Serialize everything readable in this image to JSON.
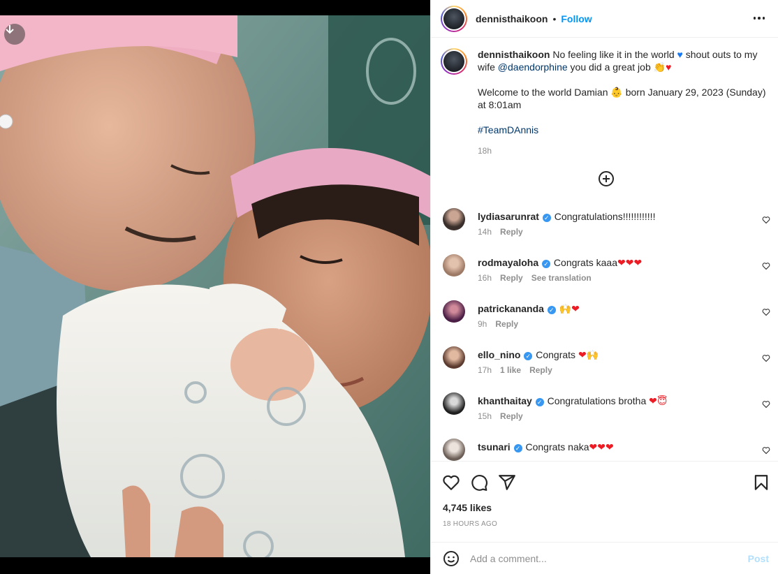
{
  "post": {
    "username": "dennisthaikoon",
    "dot": "•",
    "follow_label": "Follow",
    "caption_line1_pre": "No feeling like it in the world",
    "caption_line1_post": "shout outs to my wife",
    "mention": "@daendorphine",
    "caption_line1_end": "you did a great job",
    "caption_line2": "Welcome to the world Damian",
    "caption_line2_post": "born January 29, 2023 (Sunday) at 8:01am",
    "hashtag": "#TeamDAnnis",
    "caption_time": "18h"
  },
  "comments": [
    {
      "user": "lydiasarunrat",
      "verified": true,
      "text": "Congratulations!!!!!!!!!!!!",
      "emojis": "",
      "time": "14h",
      "likes": "",
      "reply": "Reply",
      "translate": "",
      "avatar_color": "#3a2f2b"
    },
    {
      "user": "rodmayaloha",
      "verified": true,
      "text": "Congrats kaaa",
      "emojis": "❤❤❤",
      "time": "16h",
      "likes": "",
      "reply": "Reply",
      "translate": "See translation",
      "avatar_color": "#c9a58c"
    },
    {
      "user": "patrickananda",
      "verified": true,
      "text": "",
      "emojis": "🙌❤",
      "time": "9h",
      "likes": "",
      "reply": "Reply",
      "translate": "",
      "avatar_color": "#6b2a5a"
    },
    {
      "user": "ello_nino",
      "verified": true,
      "text": "Congrats",
      "emojis": "❤🙌",
      "time": "17h",
      "likes": "1 like",
      "reply": "Reply",
      "translate": "",
      "avatar_color": "#8a5a44"
    },
    {
      "user": "khanthaitay",
      "verified": true,
      "text": "Congratulations brotha",
      "emojis": "❤😇",
      "time": "15h",
      "likes": "",
      "reply": "Reply",
      "translate": "",
      "avatar_color": "#2b2b2b"
    },
    {
      "user": "tsunari",
      "verified": true,
      "text": "Congrats naka",
      "emojis": "❤❤❤",
      "time": "",
      "likes": "",
      "reply": "",
      "translate": "",
      "avatar_color": "#9a8c82"
    }
  ],
  "footer": {
    "likes": "4,745 likes",
    "ago": "18 HOURS AGO",
    "add_comment_placeholder": "Add a comment...",
    "post_label": "Post"
  },
  "icons": {
    "download": "download-arrow-icon",
    "more": "more-horizontal-icon",
    "add_more": "plus-circle-icon",
    "like": "heart-outline-icon",
    "comment": "comment-bubble-icon",
    "share": "send-paper-plane-icon",
    "save": "bookmark-icon",
    "emoji": "smiley-icon",
    "comment_like": "small-heart-icon"
  },
  "colors": {
    "accent": "#0095f6",
    "link": "#00376b",
    "verified": "#3897f0",
    "muted": "#8e8e8e"
  }
}
